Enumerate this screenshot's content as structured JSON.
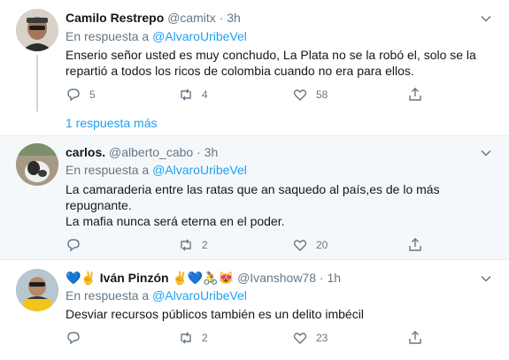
{
  "tweets": [
    {
      "name": "Camilo Restrepo",
      "handle": "@camitx",
      "dot": "·",
      "time": "3h",
      "reply_prefix": "En respuesta a",
      "reply_mention": "@AlvaroUribeVel",
      "lines": [
        "Enserio señor usted es muy conchudo, La Plata no se la robó el, solo se la",
        "repartió a todos los ricos de colombia cuando no era para ellos."
      ],
      "replies": "5",
      "retweets": "4",
      "likes": "58",
      "more_replies": "1 respuesta más"
    },
    {
      "name": "carlos.",
      "handle": "@alberto_cabo",
      "dot": "·",
      "time": "3h",
      "reply_prefix": "En respuesta a",
      "reply_mention": "@AlvaroUribeVel",
      "lines": [
        "La camaraderia entre las ratas que an saquedo al país,es de lo más",
        "repugnante.",
        "La mafia nunca será eterna en el poder."
      ],
      "replies": "",
      "retweets": "2",
      "likes": "20"
    },
    {
      "name": "Iván Pinzón",
      "name_emoji_prefix": "💙✌",
      "name_emoji_suffix": "✌💙🚴😻",
      "handle": "@Ivanshow78",
      "dot": "·",
      "time": "1h",
      "reply_prefix": "En respuesta a",
      "reply_mention": "@AlvaroUribeVel",
      "lines": [
        "Desviar recursos públicos también es un delito imbécil"
      ],
      "replies": "",
      "retweets": "2",
      "likes": "23"
    }
  ],
  "colors": {
    "accent": "#1da1f2",
    "muted": "#657786",
    "highlight_bg": "#f5f8fa",
    "divider": "#e6ecf0"
  }
}
